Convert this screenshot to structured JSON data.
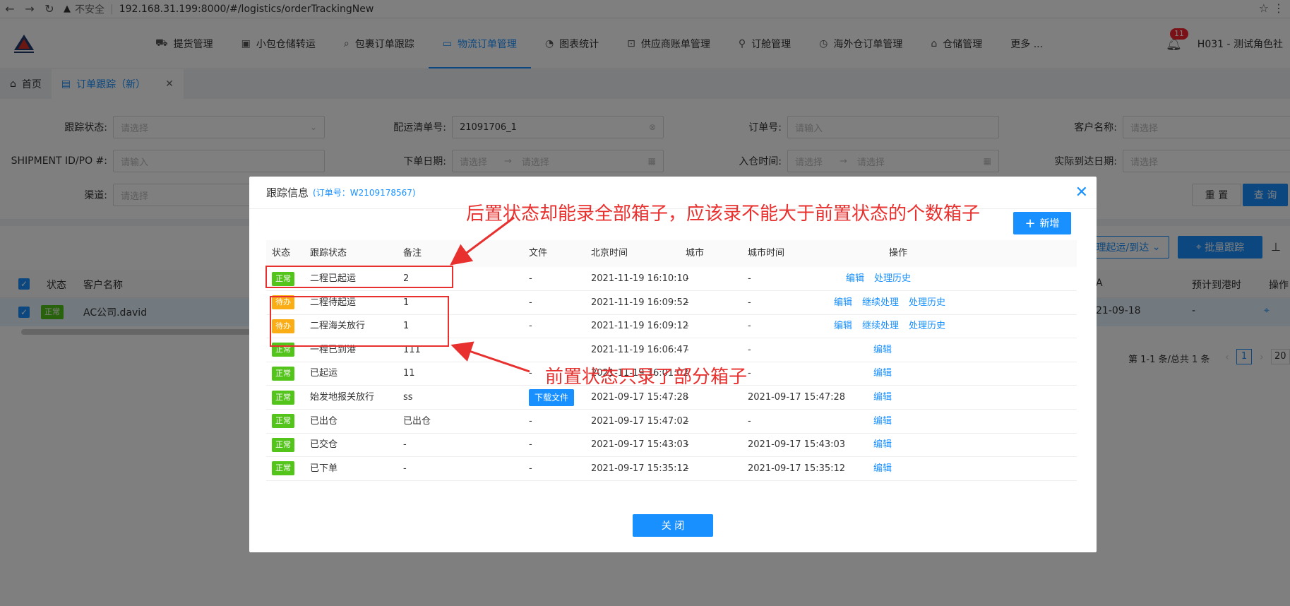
{
  "browser": {
    "insecure_label": "不安全",
    "url": "192.168.31.199:8000/#/logistics/orderTrackingNew"
  },
  "header": {
    "nav": [
      {
        "label": "提货管理",
        "icon": "car-icon"
      },
      {
        "label": "小包仓储转运",
        "icon": "box-icon"
      },
      {
        "label": "包裹订单跟踪",
        "icon": "search-icon"
      },
      {
        "label": "物流订单管理",
        "icon": "folder-icon"
      },
      {
        "label": "图表统计",
        "icon": "chart-icon"
      },
      {
        "label": "供应商账单管理",
        "icon": "bill-icon"
      },
      {
        "label": "订舱管理",
        "icon": "network-icon"
      },
      {
        "label": "海外仓订单管理",
        "icon": "dashboard-icon"
      },
      {
        "label": "仓储管理",
        "icon": "bank-icon"
      },
      {
        "label": "更多 ...",
        "icon": ""
      }
    ],
    "active_index": 3,
    "notification_count": "11",
    "user": "H031 - 测试角色社"
  },
  "tabs": [
    {
      "label": "首页"
    },
    {
      "label": "订单跟踪（新）"
    }
  ],
  "filters": {
    "track_status_label": "跟踪状态:",
    "track_status_placeholder": "请选择",
    "delivery_no_label": "配运清单号:",
    "delivery_no_value": "21091706_1",
    "order_no_label": "订单号:",
    "order_no_placeholder": "请输入",
    "customer_label": "客户名称:",
    "customer_placeholder": "请选择",
    "shipment_label": "SHIPMENT ID/PO #:",
    "shipment_placeholder": "请输入",
    "order_date_label": "下单日期:",
    "date_placeholder": "请选择",
    "warehouse_in_label": "入仓时间:",
    "arrival_label": "实际到达日期:",
    "arrival_placeholder": "请选择",
    "channel_label": "渠道:",
    "channel_placeholder": "请选择",
    "reset": "重 置",
    "query": "查 询"
  },
  "list": {
    "depart_btn": "理起运/到达",
    "batch_track_btn": "批量跟踪",
    "col_status": "状态",
    "col_customer": "客户名称",
    "col_a": "A",
    "col_eta": "预计到港时",
    "col_op": "操作",
    "row_status": "正常",
    "row_customer": "AC公司.david",
    "row_date": "21-09-18",
    "row_dash": "-",
    "pagination_text": "第 1-1 条/总共 1 条",
    "page": "1",
    "page_size": "20"
  },
  "modal": {
    "title": "跟踪信息",
    "subtitle": "(订单号：W2109178567)",
    "add_label": "新增",
    "columns": [
      "状态",
      "跟踪状态",
      "备注",
      "文件",
      "北京时间",
      "城市",
      "城市时间",
      "操作"
    ],
    "rows": [
      {
        "status": "正常",
        "color": "green",
        "track": "二程已起运",
        "note": "2",
        "file": "-",
        "bj_time": "2021-11-19 16:10:10",
        "city": "-",
        "city_time": "-",
        "actions": [
          "编辑",
          "处理历史"
        ]
      },
      {
        "status": "待办",
        "color": "orange",
        "track": "二程待起运",
        "note": "1",
        "file": "-",
        "bj_time": "2021-11-19 16:09:52",
        "city": "-",
        "city_time": "-",
        "actions": [
          "编辑",
          "继续处理",
          "处理历史"
        ]
      },
      {
        "status": "待办",
        "color": "orange",
        "track": "二程海关放行",
        "note": "1",
        "file": "-",
        "bj_time": "2021-11-19 16:09:12",
        "city": "-",
        "city_time": "-",
        "actions": [
          "编辑",
          "继续处理",
          "处理历史"
        ]
      },
      {
        "status": "正常",
        "color": "green",
        "track": "一程已到港",
        "note": "111",
        "file": "",
        "bj_time": "2021-11-19 16:06:47",
        "city": "-",
        "city_time": "-",
        "actions": [
          "编辑"
        ]
      },
      {
        "status": "正常",
        "color": "green",
        "track": "已起运",
        "note": "11",
        "file": "-",
        "bj_time": "2021-11-19 16:01:02",
        "city": "-",
        "city_time": "-",
        "actions": [
          "编辑"
        ]
      },
      {
        "status": "正常",
        "color": "green",
        "track": "始发地报关放行",
        "note": "ss",
        "file": "下载文件",
        "bj_time": "2021-09-17 15:47:28",
        "city": "-",
        "city_time": "2021-09-17 15:47:28",
        "actions": [
          "编辑"
        ]
      },
      {
        "status": "正常",
        "color": "green",
        "track": "已出仓",
        "note": "已出仓",
        "file": "-",
        "bj_time": "2021-09-17 15:47:02",
        "city": "-",
        "city_time": "-",
        "actions": [
          "编辑"
        ]
      },
      {
        "status": "正常",
        "color": "green",
        "track": "已交仓",
        "note": "-",
        "file": "-",
        "bj_time": "2021-09-17 15:43:03",
        "city": "-",
        "city_time": "2021-09-17 15:43:03",
        "actions": [
          "编辑"
        ]
      },
      {
        "status": "正常",
        "color": "green",
        "track": "已下单",
        "note": "-",
        "file": "-",
        "bj_time": "2021-09-17 15:35:12",
        "city": "-",
        "city_time": "2021-09-17 15:35:12",
        "actions": [
          "编辑"
        ]
      }
    ],
    "close_label": "关 闭"
  },
  "annotations": {
    "top": "后置状态却能录全部箱子，应该录不能大于前置状态的个数箱子",
    "bottom": "前置状态只录了部分箱子"
  }
}
